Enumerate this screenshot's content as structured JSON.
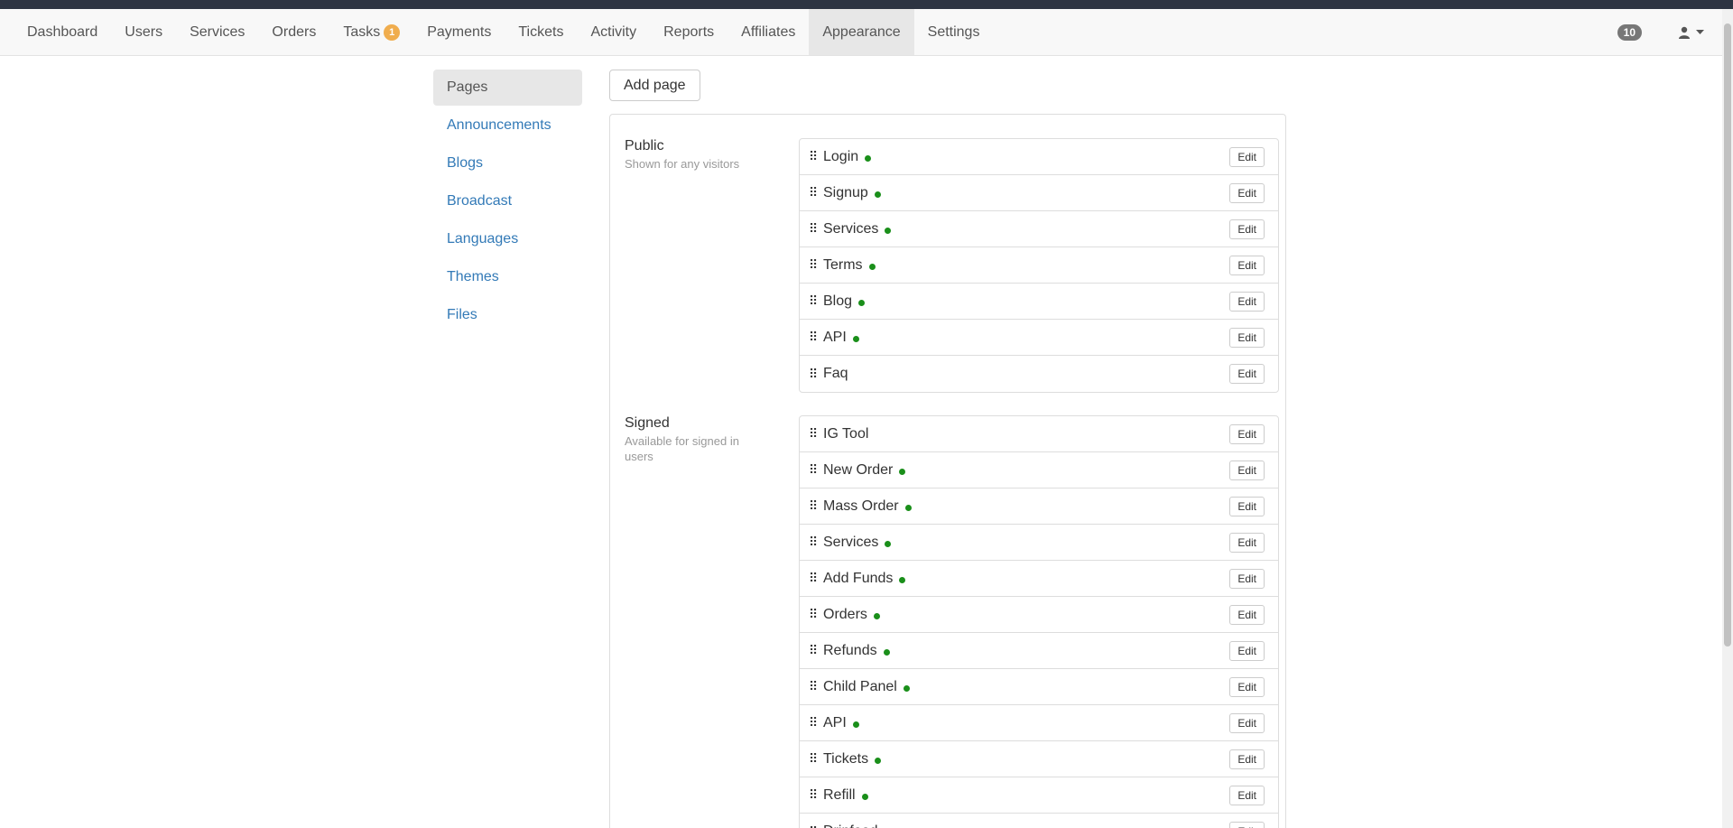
{
  "nav": {
    "items": [
      {
        "label": "Dashboard"
      },
      {
        "label": "Users"
      },
      {
        "label": "Services"
      },
      {
        "label": "Orders"
      },
      {
        "label": "Tasks",
        "badge": "1"
      },
      {
        "label": "Payments"
      },
      {
        "label": "Tickets"
      },
      {
        "label": "Activity"
      },
      {
        "label": "Reports"
      },
      {
        "label": "Affiliates"
      },
      {
        "label": "Appearance",
        "active": true
      },
      {
        "label": "Settings"
      }
    ],
    "notification_count": "10",
    "user_icon": "user-icon",
    "caret_icon": "caret-down-icon"
  },
  "sidebar": {
    "items": [
      {
        "label": "Pages",
        "active": true
      },
      {
        "label": "Announcements"
      },
      {
        "label": "Blogs"
      },
      {
        "label": "Broadcast"
      },
      {
        "label": "Languages"
      },
      {
        "label": "Themes"
      },
      {
        "label": "Files"
      }
    ]
  },
  "toolbar": {
    "add_page_label": "Add page"
  },
  "edit_label": "Edit",
  "sections": [
    {
      "title": "Public",
      "subtitle": "Shown for any visitors",
      "pages": [
        {
          "name": "Login",
          "active": true
        },
        {
          "name": "Signup",
          "active": true
        },
        {
          "name": "Services",
          "active": true
        },
        {
          "name": "Terms",
          "active": true
        },
        {
          "name": "Blog",
          "active": true
        },
        {
          "name": "API",
          "active": true
        },
        {
          "name": "Faq",
          "active": false
        }
      ]
    },
    {
      "title": "Signed",
      "subtitle": "Available for signed in users",
      "pages": [
        {
          "name": "IG Tool",
          "active": false
        },
        {
          "name": "New Order",
          "active": true
        },
        {
          "name": "Mass Order",
          "active": true
        },
        {
          "name": "Services",
          "active": true
        },
        {
          "name": "Add Funds",
          "active": true
        },
        {
          "name": "Orders",
          "active": true
        },
        {
          "name": "Refunds",
          "active": true
        },
        {
          "name": "Child Panel",
          "active": true
        },
        {
          "name": "API",
          "active": true
        },
        {
          "name": "Tickets",
          "active": true
        },
        {
          "name": "Refill",
          "active": true
        },
        {
          "name": "Dripfeed",
          "active": true
        }
      ]
    }
  ],
  "colors": {
    "active_dot": "#1a8f1a",
    "link": "#337ab7",
    "task_badge": "#f0ad4e"
  }
}
